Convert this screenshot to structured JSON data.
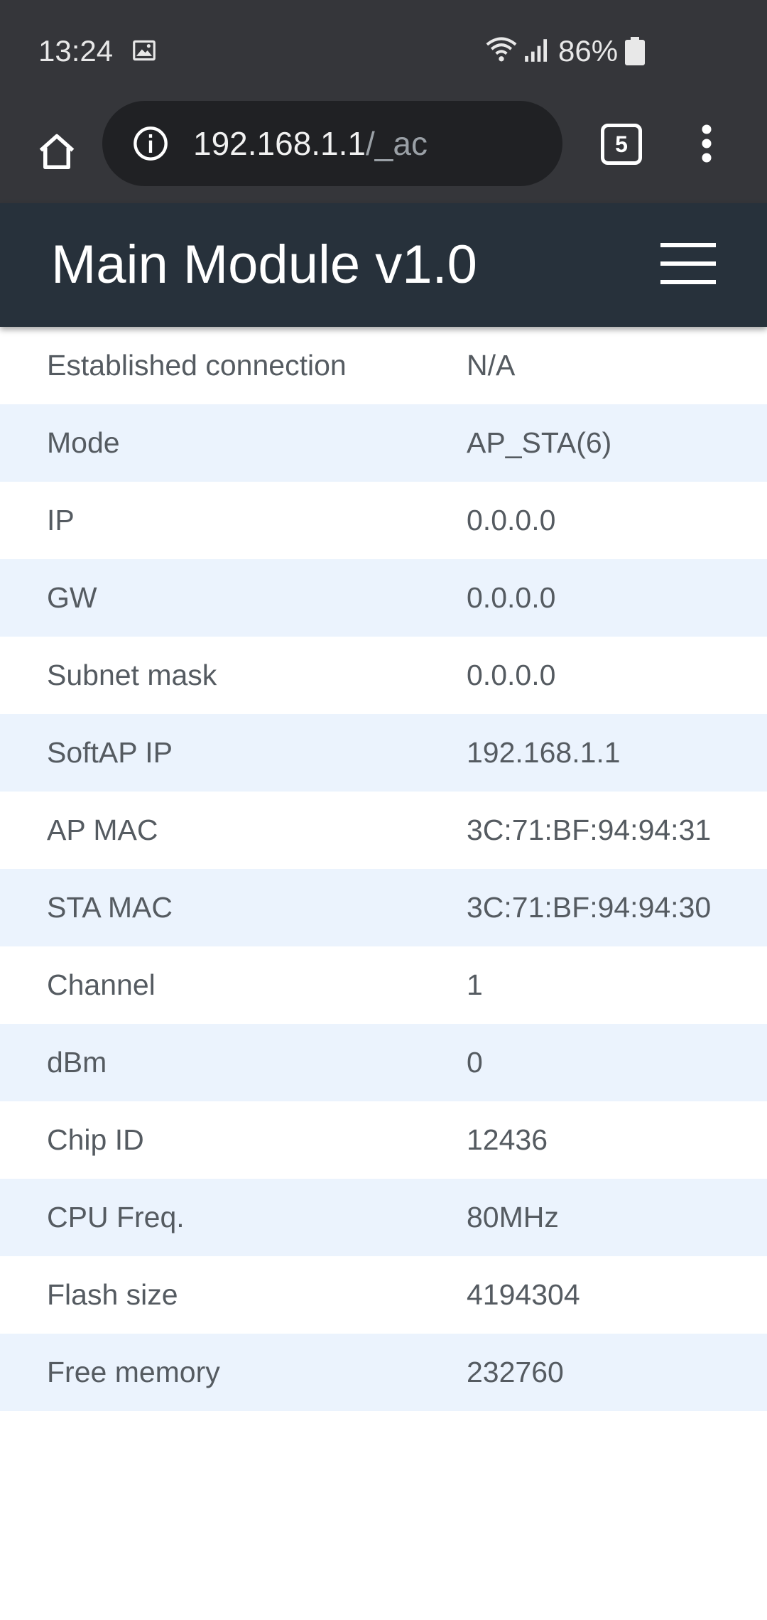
{
  "status_bar": {
    "time": "13:24",
    "battery": "86%",
    "icons": [
      "gallery-icon",
      "wifi-icon",
      "signal-icon",
      "battery-icon"
    ]
  },
  "browser": {
    "url_host": "192.168.1.1",
    "url_path": "/_ac",
    "tab_count": "5"
  },
  "header": {
    "title": "Main Module v1.0"
  },
  "colors": {
    "status_bar_bg": "#35363a",
    "header_bg": "#27313b",
    "row_alt_bg": "#ebf3fd",
    "text": "#555b61"
  },
  "table": {
    "rows": [
      {
        "label": "Established connection",
        "value": "N/A"
      },
      {
        "label": "Mode",
        "value": "AP_STA(6)"
      },
      {
        "label": "IP",
        "value": "0.0.0.0"
      },
      {
        "label": "GW",
        "value": "0.0.0.0"
      },
      {
        "label": "Subnet mask",
        "value": "0.0.0.0"
      },
      {
        "label": "SoftAP IP",
        "value": "192.168.1.1"
      },
      {
        "label": "AP MAC",
        "value": "3C:71:BF:94:94:31"
      },
      {
        "label": "STA MAC",
        "value": "3C:71:BF:94:94:30"
      },
      {
        "label": "Channel",
        "value": "1"
      },
      {
        "label": "dBm",
        "value": "0"
      },
      {
        "label": "Chip ID",
        "value": "12436"
      },
      {
        "label": "CPU Freq.",
        "value": "80MHz"
      },
      {
        "label": "Flash size",
        "value": "4194304"
      },
      {
        "label": "Free memory",
        "value": "232760"
      }
    ]
  }
}
